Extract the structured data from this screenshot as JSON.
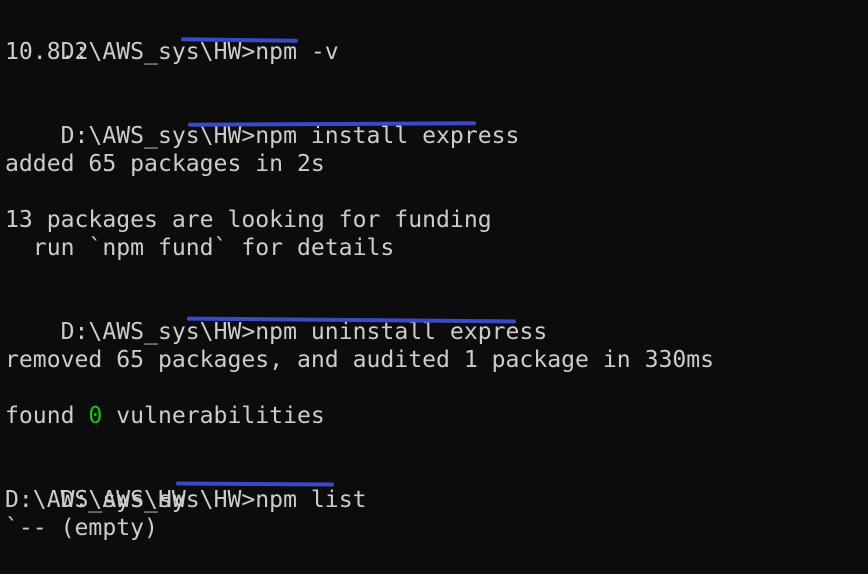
{
  "terminal": {
    "lines": {
      "l1": {
        "prompt": "D:\\AWS_sys\\HW>",
        "command": "npm -v"
      },
      "l2": {
        "text": "10.8.2"
      },
      "l4": {
        "prompt": "D:\\AWS_sys\\HW>",
        "command": "npm install express"
      },
      "l6": {
        "text": "added 65 packages in 2s"
      },
      "l8": {
        "text": "13 packages are looking for funding"
      },
      "l9": {
        "text": "  run `npm fund` for details"
      },
      "l11": {
        "prompt": "D:\\AWS_sys\\HW>",
        "command": "npm uninstall express"
      },
      "l13": {
        "text": "removed 65 packages, and audited 1 package in 330ms"
      },
      "l15": {
        "prefix": "found ",
        "count": "0",
        "suffix": " vulnerabilities"
      },
      "l17": {
        "prompt": "D:\\AWS_sys\\HW>",
        "command": "npm list"
      },
      "l18": {
        "text": "D:\\AWS_sys\\HW"
      },
      "l19": {
        "text": "`-- (empty)"
      }
    },
    "colors": {
      "background": "#0c0c0c",
      "text": "#cccccc",
      "success": "#16c60c",
      "annotation_underline": "#3b48c9"
    }
  }
}
